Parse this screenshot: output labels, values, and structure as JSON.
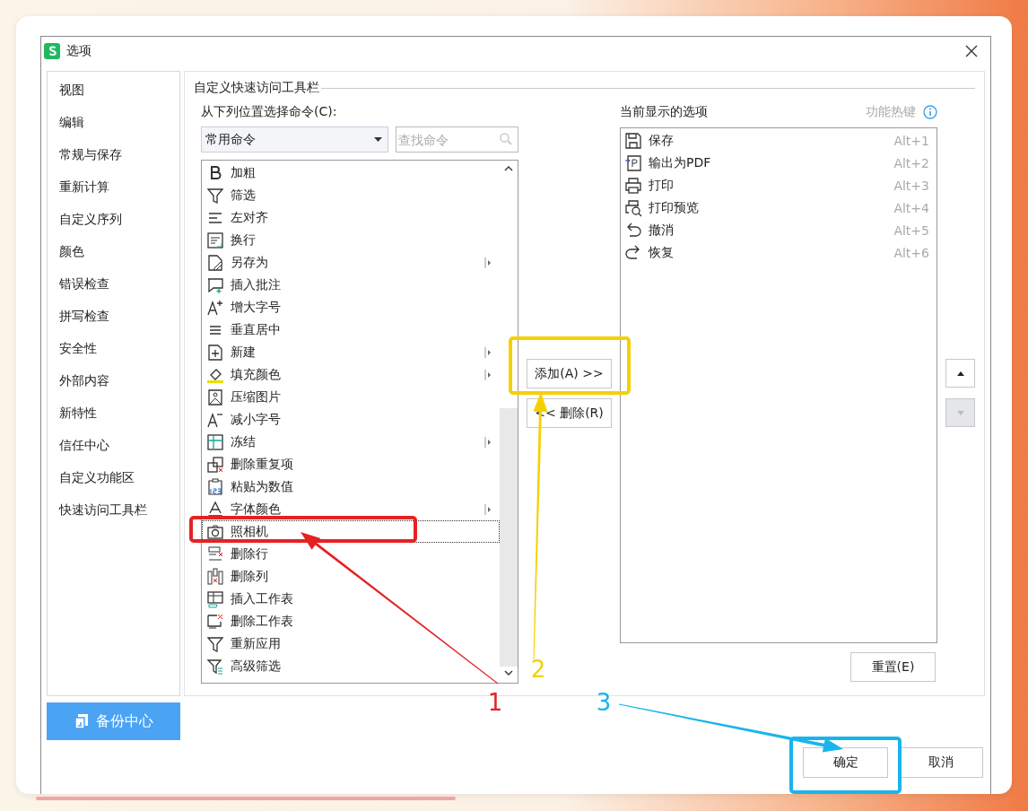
{
  "window": {
    "title": "选项"
  },
  "sidebar": {
    "items": [
      {
        "label": "视图"
      },
      {
        "label": "编辑"
      },
      {
        "label": "常规与保存"
      },
      {
        "label": "重新计算"
      },
      {
        "label": "自定义序列"
      },
      {
        "label": "颜色"
      },
      {
        "label": "错误检查"
      },
      {
        "label": "拼写检查"
      },
      {
        "label": "安全性"
      },
      {
        "label": "外部内容"
      },
      {
        "label": "新特性"
      },
      {
        "label": "信任中心"
      },
      {
        "label": "自定义功能区"
      },
      {
        "label": "快速访问工具栏"
      }
    ],
    "backup_button": "备份中心"
  },
  "group_title": "自定义快速访问工具栏",
  "commands": {
    "label": "从下列位置选择命令(C):",
    "dropdown": "常用命令",
    "search": {
      "placeholder": "查找命令"
    },
    "items": [
      {
        "label": "加粗",
        "submenu": false,
        "selected": false
      },
      {
        "label": "筛选",
        "submenu": false,
        "selected": false
      },
      {
        "label": "左对齐",
        "submenu": false,
        "selected": false
      },
      {
        "label": "换行",
        "submenu": false,
        "selected": false
      },
      {
        "label": "另存为",
        "submenu": true,
        "selected": false
      },
      {
        "label": "插入批注",
        "submenu": false,
        "selected": false
      },
      {
        "label": "增大字号",
        "submenu": false,
        "selected": false
      },
      {
        "label": "垂直居中",
        "submenu": false,
        "selected": false
      },
      {
        "label": "新建",
        "submenu": true,
        "selected": false
      },
      {
        "label": "填充颜色",
        "submenu": true,
        "selected": false
      },
      {
        "label": "压缩图片",
        "submenu": false,
        "selected": false
      },
      {
        "label": "减小字号",
        "submenu": false,
        "selected": false
      },
      {
        "label": "冻结",
        "submenu": true,
        "selected": false
      },
      {
        "label": "删除重复项",
        "submenu": false,
        "selected": false
      },
      {
        "label": "粘贴为数值",
        "submenu": false,
        "selected": false
      },
      {
        "label": "字体颜色",
        "submenu": true,
        "selected": false
      },
      {
        "label": "照相机",
        "submenu": false,
        "selected": true
      },
      {
        "label": "删除行",
        "submenu": false,
        "selected": false
      },
      {
        "label": "删除列",
        "submenu": false,
        "selected": false
      },
      {
        "label": "插入工作表",
        "submenu": false,
        "selected": false
      },
      {
        "label": "删除工作表",
        "submenu": false,
        "selected": false
      },
      {
        "label": "重新应用",
        "submenu": false,
        "selected": false
      },
      {
        "label": "高级筛选",
        "submenu": false,
        "selected": false
      }
    ]
  },
  "add_button": "添加(A) >>",
  "remove_button": "<< 删除(R)",
  "current": {
    "label": "当前显示的选项",
    "hotkey_label": "功能热键",
    "items": [
      {
        "label": "保存",
        "shortcut": "Alt+1"
      },
      {
        "label": "输出为PDF",
        "shortcut": "Alt+2"
      },
      {
        "label": "打印",
        "shortcut": "Alt+3"
      },
      {
        "label": "打印预览",
        "shortcut": "Alt+4"
      },
      {
        "label": "撤消",
        "shortcut": "Alt+5"
      },
      {
        "label": "恢复",
        "shortcut": "Alt+6"
      }
    ]
  },
  "move_up": {
    "disabled": false
  },
  "move_down": {
    "disabled": true
  },
  "reset_button": "重置(E)",
  "ok_button": "确定",
  "cancel_button": "取消",
  "annotations": [
    {
      "number": "1",
      "color": "#e52222"
    },
    {
      "number": "2",
      "color": "#f5d000"
    },
    {
      "number": "3",
      "color": "#1ab4ec"
    }
  ]
}
